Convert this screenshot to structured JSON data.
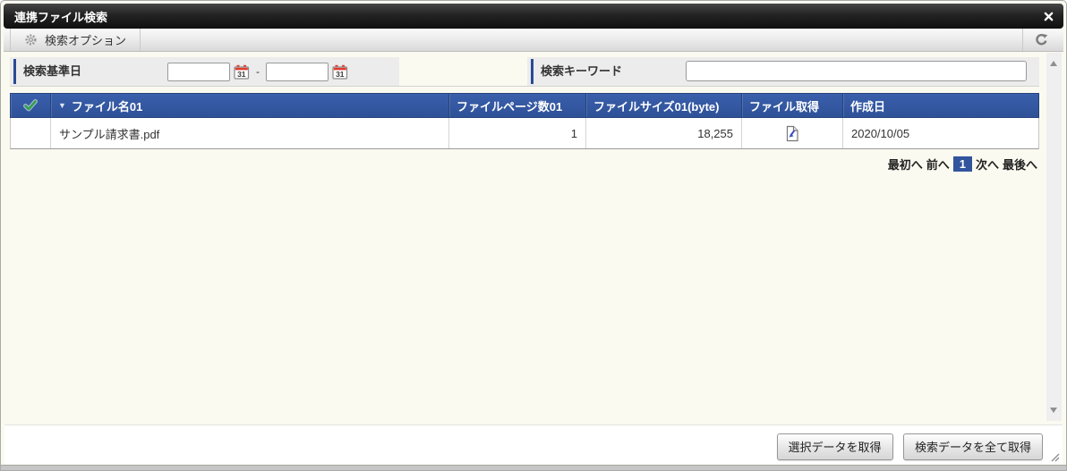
{
  "dialog": {
    "title": "連携ファイル検索"
  },
  "toolbar": {
    "search_options_label": "検索オプション"
  },
  "search": {
    "date_label": "検索基準日",
    "date_from_value": "",
    "date_to_value": "",
    "date_separator": "-",
    "keyword_label": "検索キーワード",
    "keyword_value": ""
  },
  "table": {
    "sort_indicator": "▼",
    "columns": [
      {
        "label": ""
      },
      {
        "label": "ファイル名01"
      },
      {
        "label": "ファイルページ数01"
      },
      {
        "label": "ファイルサイズ01(byte)"
      },
      {
        "label": "ファイル取得"
      },
      {
        "label": "作成日"
      }
    ],
    "rows": [
      {
        "file_name": "サンプル請求書.pdf",
        "page_count": "1",
        "file_size_bytes": "18,255",
        "created_date": "2020/10/05"
      }
    ]
  },
  "pagination": {
    "first": "最初へ",
    "prev": "前へ",
    "current_page": "1",
    "next": "次へ",
    "last": "最後へ"
  },
  "footer": {
    "get_selected_label": "選択データを取得",
    "get_all_label": "検索データを全て取得"
  },
  "colors": {
    "header_blue": "#31549d",
    "accent_blue": "#2b4a96",
    "titlebar_dark": "#1d1d1d",
    "pagination_active_bg": "#31549d",
    "check_green": "#2fa14c",
    "calendar_red": "#e23b2e",
    "file_arrow_blue": "#3a4fc0"
  }
}
